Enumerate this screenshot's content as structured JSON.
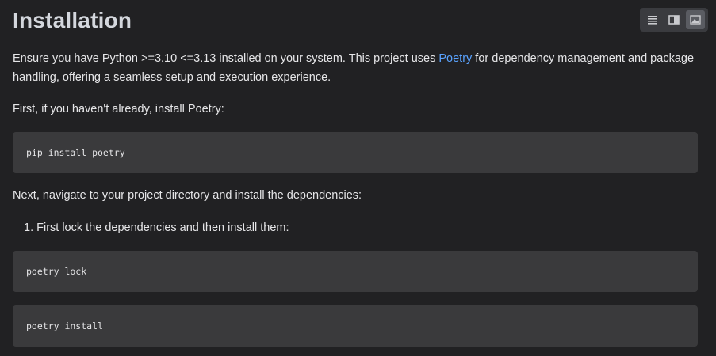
{
  "page": {
    "title": "Installation",
    "intro": {
      "before_link": "Ensure you have Python >=3.10 <=3.13 installed on your system. This project uses ",
      "link_text": "Poetry",
      "after_link": " for dependency management and package handling, offering a seamless setup and execution experience."
    },
    "step_first": "First, if you haven't already, install Poetry:",
    "code_install_poetry": "pip install poetry",
    "step_next": "Next, navigate to your project directory and install the dependencies:",
    "list": [
      {
        "number": "1.",
        "text": "First lock the dependencies and then install them:"
      }
    ],
    "code_lock": "poetry lock",
    "code_install": "poetry install"
  },
  "toolbar": {
    "buttons": [
      {
        "icon": "text-lines-icon",
        "active": false
      },
      {
        "icon": "split-view-icon",
        "active": false
      },
      {
        "icon": "image-icon",
        "active": true
      }
    ]
  },
  "colors": {
    "background": "#212123",
    "code_background": "#3a3a3c",
    "link": "#5aa3ff",
    "heading": "#d4d7dd"
  }
}
